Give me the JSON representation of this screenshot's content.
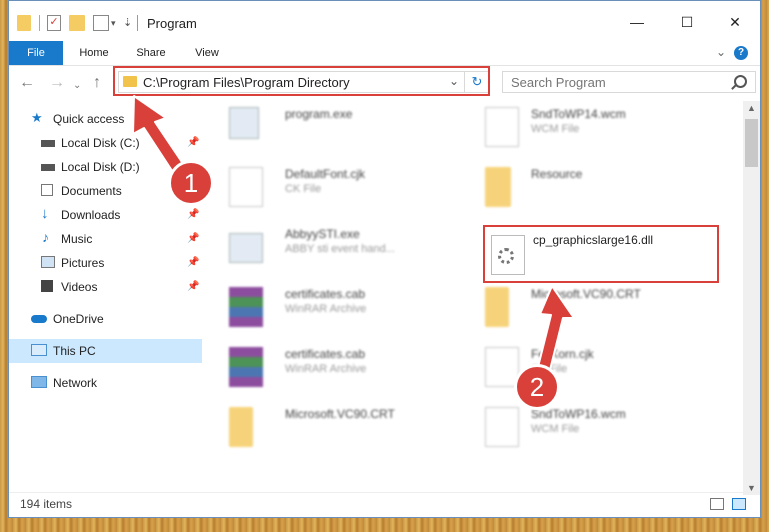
{
  "window": {
    "title": "Program"
  },
  "window_controls": {
    "minimize": "—",
    "maximize": "☐",
    "close": "✕"
  },
  "ribbon": {
    "tabs": [
      "File",
      "Home",
      "Share",
      "View"
    ],
    "help": "?"
  },
  "address": {
    "path": "C:\\Program Files\\Program Directory"
  },
  "search": {
    "placeholder": "Search Program"
  },
  "nav": {
    "items": [
      {
        "label": "Quick access",
        "icon": "star-icon",
        "pinned": false
      },
      {
        "label": "Local Disk (C:)",
        "icon": "drive-icon",
        "pinned": true
      },
      {
        "label": "Local Disk (D:)",
        "icon": "drive-icon",
        "pinned": false
      },
      {
        "label": "Documents",
        "icon": "documents-icon",
        "pinned": true
      },
      {
        "label": "Downloads",
        "icon": "downloads-icon",
        "pinned": true
      },
      {
        "label": "Music",
        "icon": "music-icon",
        "pinned": true
      },
      {
        "label": "Pictures",
        "icon": "pictures-icon",
        "pinned": true
      },
      {
        "label": "Videos",
        "icon": "videos-icon",
        "pinned": true
      },
      {
        "label": "OneDrive",
        "icon": "cloud-icon",
        "pinned": false
      },
      {
        "label": "This PC",
        "icon": "computer-icon",
        "pinned": false
      },
      {
        "label": "Network",
        "icon": "network-icon",
        "pinned": false
      }
    ]
  },
  "files": {
    "left": [
      {
        "name": "program.exe",
        "sub": "",
        "icon": "program-icon"
      },
      {
        "name": "DefaultFont.cjk",
        "sub": "CK File",
        "icon": "document-icon"
      },
      {
        "name": "AbbyySTI.exe",
        "sub": "ABBY sti event hand...",
        "icon": "exe-icon"
      },
      {
        "name": "certificates.cab",
        "sub": "WinRAR Archive",
        "icon": "winrar-icon"
      },
      {
        "name": "certificates.cab",
        "sub": "WinRAR Archive",
        "icon": "winrar-icon"
      },
      {
        "name": "Microsoft.VC90.CRT",
        "sub": "",
        "icon": "folder-icon"
      }
    ],
    "right": [
      {
        "name": "SndToWP14.wcm",
        "sub": "WCM File",
        "icon": "document-icon"
      },
      {
        "name": "Resource",
        "sub": "",
        "icon": "folder-icon"
      },
      {
        "name": "cp_graphicslarge16.dll",
        "sub": "",
        "icon": "dll-gear-icon"
      },
      {
        "name": "Microsoft.VC90.CRT",
        "sub": "",
        "icon": "folder-icon"
      },
      {
        "name": "FeliKorn.cjk",
        "sub": "CK File",
        "icon": "document-icon"
      },
      {
        "name": "SndToWP16.wcm",
        "sub": "WCM File",
        "icon": "document-icon"
      }
    ]
  },
  "status": {
    "item_count": "194 items"
  },
  "annotations": {
    "step1": "1",
    "step2": "2",
    "color": "#d9403a"
  }
}
